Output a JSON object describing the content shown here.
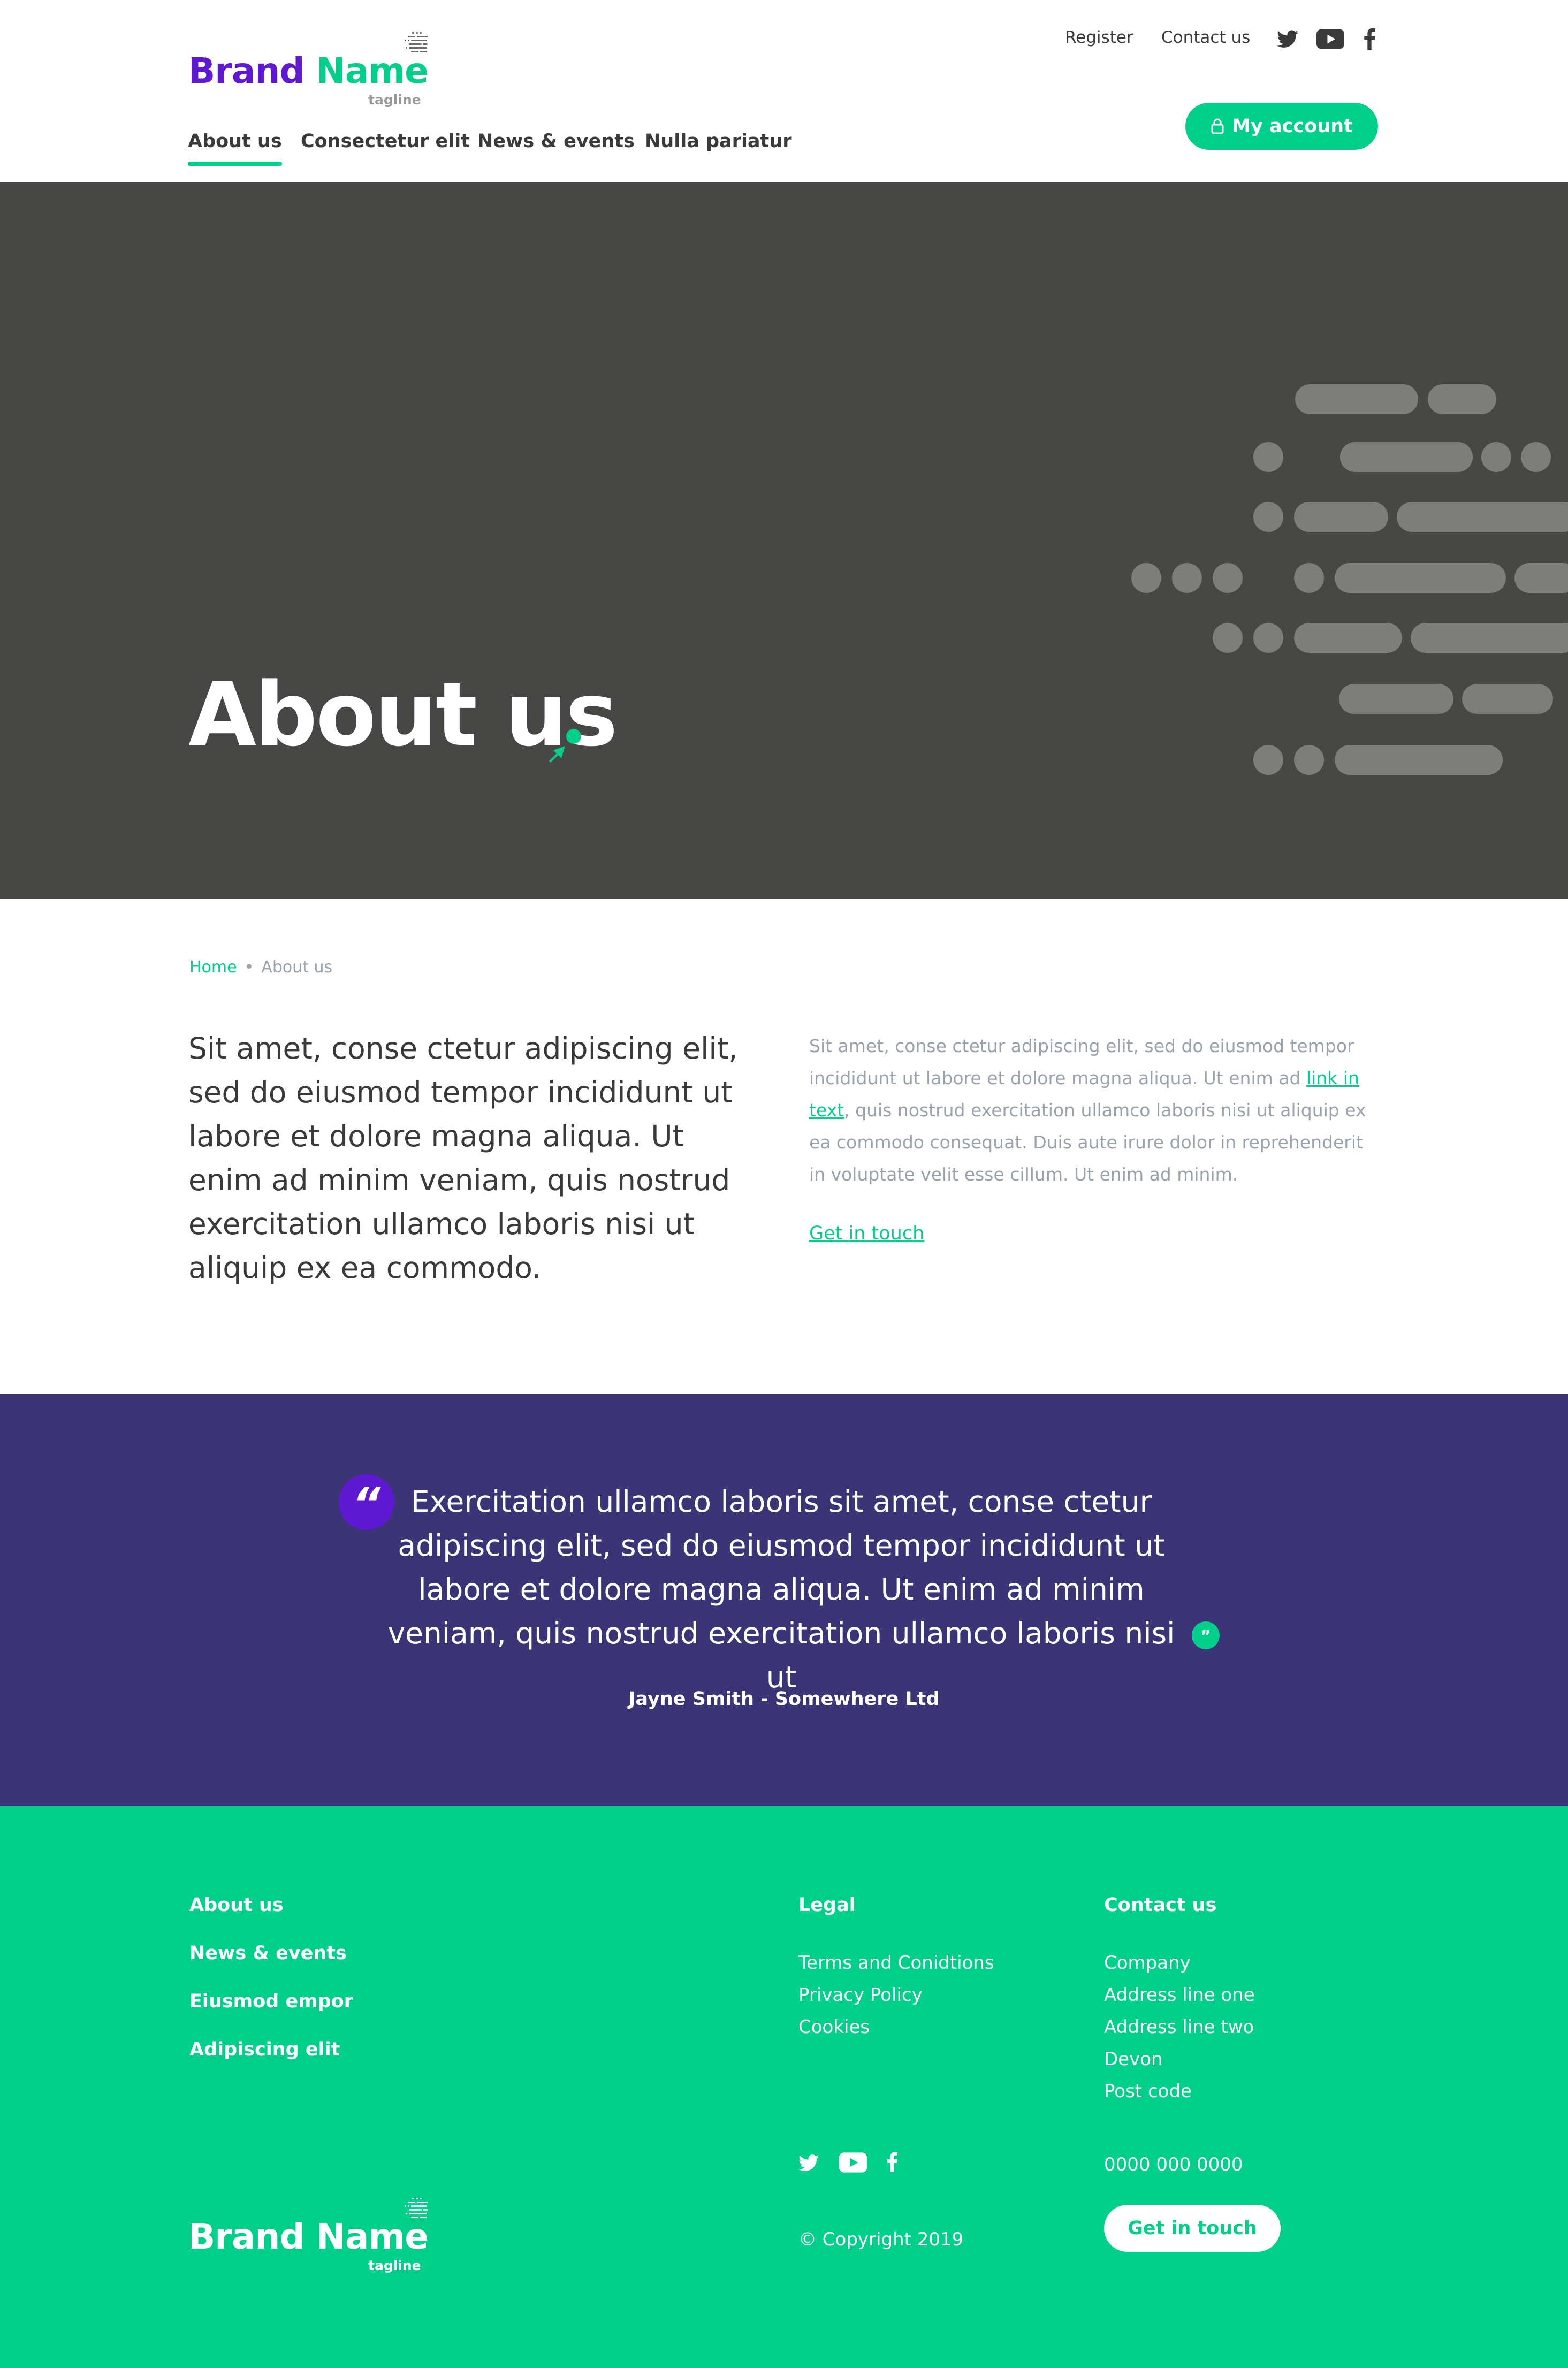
{
  "brand": {
    "name_part1": "Brand",
    "name_part2": "Name",
    "tagline": "tagline"
  },
  "top_links": {
    "register": "Register",
    "contact": "Contact us"
  },
  "social_icons": [
    "twitter-icon",
    "youtube-icon",
    "facebook-icon"
  ],
  "main_nav": [
    {
      "label": "About us",
      "active": true
    },
    {
      "label": "Consectetur elit",
      "active": false
    },
    {
      "label": "News & events",
      "active": false
    },
    {
      "label": "Nulla pariatur",
      "active": false
    }
  ],
  "account_button": {
    "label": "My account",
    "icon": "lock-icon"
  },
  "hero": {
    "title": "About us"
  },
  "breadcrumb": {
    "home": "Home",
    "separator": "•",
    "current": "About us"
  },
  "content": {
    "lead": "Sit amet, conse ctetur adipiscing elit, sed do eiusmod tempor incididunt ut labore et dolore magna aliqua. Ut enim ad minim veniam, quis nostrud exercitation ullamco laboris nisi ut aliquip ex ea commodo.",
    "body_before_link": "Sit amet, conse ctetur adipiscing elit, sed do eiusmod tempor incididunt ut labore et dolore magna aliqua. Ut enim ad ",
    "body_link": "link in text",
    "body_after_link": ", quis nostrud exercitation ullamco laboris nisi ut aliquip ex ea commodo consequat. Duis aute irure dolor in reprehenderit in voluptate velit esse cillum. Ut enim ad minim.",
    "cta_link": "Get in touch"
  },
  "quote": {
    "open_mark": "“",
    "close_mark": "”",
    "text": "Exercitation ullamco laboris sit amet, conse ctetur adipiscing elit, sed do eiusmod tempor incididunt ut labore et dolore magna aliqua. Ut enim ad minim veniam, quis nostrud exercitation ullamco laboris nisi ut",
    "author": "Jayne Smith - Somewhere Ltd"
  },
  "footer": {
    "nav": [
      "About us",
      "News & events",
      "Eiusmod empor",
      "Adipiscing elit"
    ],
    "legal": {
      "heading": "Legal",
      "links": [
        "Terms and Conidtions",
        "Privacy Policy",
        "Cookies"
      ]
    },
    "contact": {
      "heading": "Contact us",
      "address": [
        "Company",
        "Address line one",
        "Address line two",
        "Devon",
        "Post code"
      ],
      "phone": "0000 000 0000",
      "button": "Get in touch"
    },
    "copyright": "© Copyright 2019"
  },
  "colors": {
    "purple": "#6019d2",
    "green": "#00cf8a",
    "hero_bg": "#474846",
    "quote_bg": "#3b3477",
    "text": "#3a3a3a",
    "muted": "#9aa3ad"
  }
}
